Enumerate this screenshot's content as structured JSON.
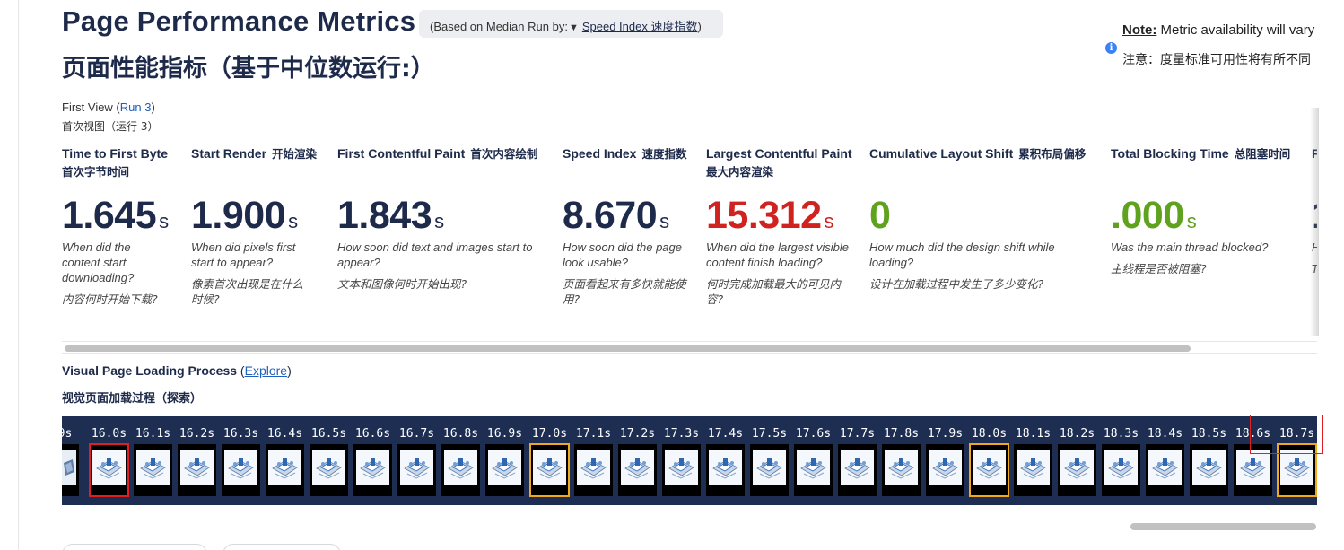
{
  "header": {
    "title": "Page Performance Metrics",
    "title_zh": "页面性能指标（基于中位数运行:）",
    "median_prefix": "(Based on Median Run by:",
    "median_caret": "▼",
    "median_metric": "Speed Index  速度指数",
    "median_suffix": ")"
  },
  "note": {
    "label": "Note:",
    "text": " Metric availability will vary",
    "text_zh": "注意：度量标准可用性将有所不同",
    "icon": "info-icon"
  },
  "first_view": {
    "prefix": "First View (",
    "run_link": "Run 3",
    "suffix": ")",
    "zh": "首次视图（运行 3）"
  },
  "metrics": [
    {
      "label": "Time to First Byte",
      "label_zh": "",
      "label_zh_line2": "首次字节时间",
      "value": "1.645",
      "unit": "s",
      "status": "normal",
      "desc": "When did the content start downloading?",
      "desc_zh": "内容何时开始下载?"
    },
    {
      "label": "Start Render",
      "label_zh": "开始渲染",
      "label_zh_line2": "",
      "value": "1.900",
      "unit": "s",
      "status": "normal",
      "desc": "When did pixels first start to appear?",
      "desc_zh": "像素首次出现是在什么时候?"
    },
    {
      "label": "First Contentful Paint",
      "label_zh": "首次内容绘制",
      "label_zh_line2": "",
      "value": "1.843",
      "unit": "s",
      "status": "normal",
      "desc": "How soon did text and images start to appear?",
      "desc_zh": "文本和图像何时开始出现?"
    },
    {
      "label": "Speed Index",
      "label_zh": "速度指数",
      "label_zh_line2": "",
      "value": "8.670",
      "unit": "s",
      "status": "normal",
      "desc": "How soon did the page look usable?",
      "desc_zh": "页面看起来有多快就能使用?"
    },
    {
      "label": "Largest Contentful Paint",
      "label_zh": "",
      "label_zh_line2": "最大内容渲染",
      "value": "15.312",
      "unit": "s",
      "status": "bad",
      "desc": "When did the largest visible content finish loading?",
      "desc_zh": "何时完成加载最大的可见内容?"
    },
    {
      "label": "Cumulative Layout Shift",
      "label_zh": "累积布局偏移",
      "label_zh_line2": "",
      "value": "0",
      "unit": "",
      "status": "good",
      "desc": "How much did the design shift while loading?",
      "desc_zh": "设计在加载过程中发生了多少变化?"
    },
    {
      "label": "Total Blocking Time",
      "label_zh": "总阻塞时间",
      "label_zh_line2": "",
      "value": ".000",
      "unit": "s",
      "status": "good",
      "desc": "Was the main thread blocked?",
      "desc_zh": "主线程是否被阻塞?"
    },
    {
      "label": "P",
      "label_zh": "",
      "label_zh_line2": "",
      "value": "1",
      "unit": "",
      "status": "normal",
      "desc": "H o",
      "desc_zh": "T"
    }
  ],
  "visual": {
    "title": "Visual Page Loading Process",
    "paren_open": " (",
    "explore_link": "Explore",
    "paren_close": ")",
    "title_zh": "视觉页面加载过程（探索）"
  },
  "filmstrip": {
    "first_partial_label": "9s",
    "frames": [
      {
        "time": "16.0s",
        "highlight": "red"
      },
      {
        "time": "16.1s",
        "highlight": ""
      },
      {
        "time": "16.2s",
        "highlight": ""
      },
      {
        "time": "16.3s",
        "highlight": ""
      },
      {
        "time": "16.4s",
        "highlight": ""
      },
      {
        "time": "16.5s",
        "highlight": ""
      },
      {
        "time": "16.6s",
        "highlight": ""
      },
      {
        "time": "16.7s",
        "highlight": ""
      },
      {
        "time": "16.8s",
        "highlight": ""
      },
      {
        "time": "16.9s",
        "highlight": ""
      },
      {
        "time": "17.0s",
        "highlight": "orange"
      },
      {
        "time": "17.1s",
        "highlight": ""
      },
      {
        "time": "17.2s",
        "highlight": ""
      },
      {
        "time": "17.3s",
        "highlight": ""
      },
      {
        "time": "17.4s",
        "highlight": ""
      },
      {
        "time": "17.5s",
        "highlight": ""
      },
      {
        "time": "17.6s",
        "highlight": ""
      },
      {
        "time": "17.7s",
        "highlight": ""
      },
      {
        "time": "17.8s",
        "highlight": ""
      },
      {
        "time": "17.9s",
        "highlight": ""
      },
      {
        "time": "18.0s",
        "highlight": "orange"
      },
      {
        "time": "18.1s",
        "highlight": ""
      },
      {
        "time": "18.2s",
        "highlight": ""
      },
      {
        "time": "18.3s",
        "highlight": ""
      },
      {
        "time": "18.4s",
        "highlight": ""
      },
      {
        "time": "18.5s",
        "highlight": ""
      },
      {
        "time": "18.6s",
        "highlight": ""
      },
      {
        "time": "18.7s",
        "highlight": "orange"
      }
    ]
  },
  "colors": {
    "navy": "#1e2a4a",
    "bad": "#d0221f",
    "good": "#5fa21e",
    "link": "#1f5fbf",
    "filmstrip_bg": "#1d2e52",
    "highlight_red": "#e02020",
    "highlight_orange": "#f0a81c"
  }
}
